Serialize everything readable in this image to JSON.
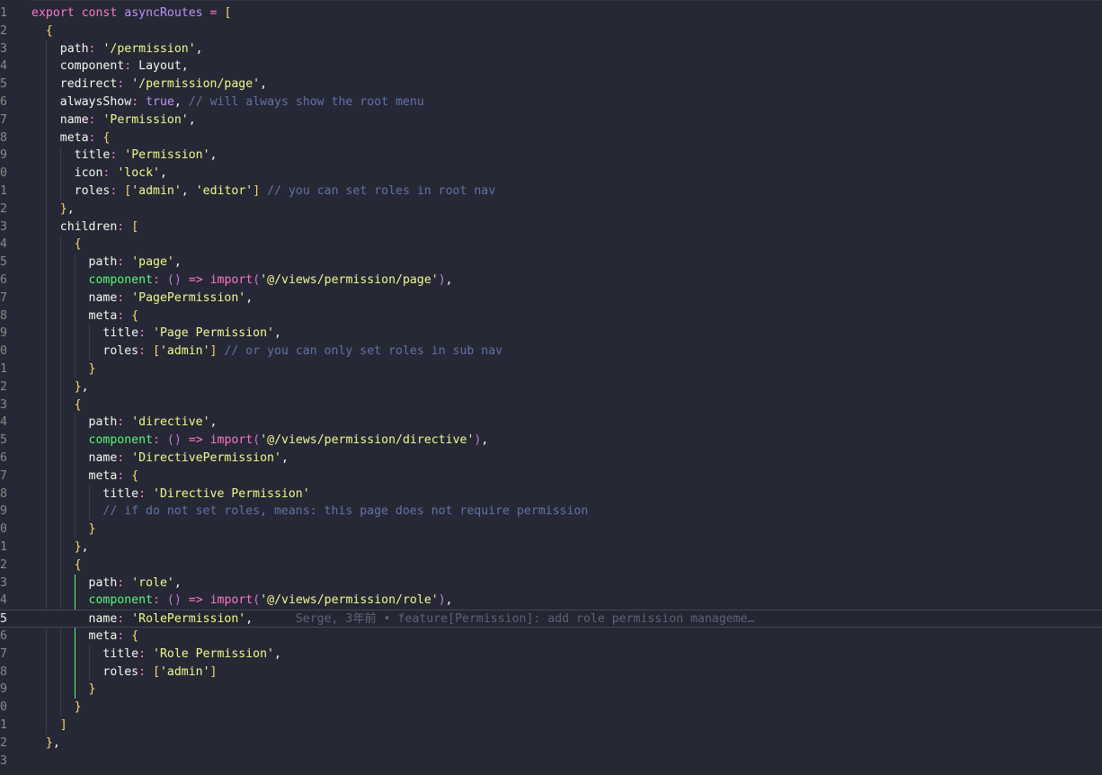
{
  "editor": {
    "line_numbers": [
      "1",
      "2",
      "3",
      "4",
      "5",
      "6",
      "7",
      "8",
      "9",
      "0",
      "1",
      "2",
      "3",
      "4",
      "5",
      "6",
      "7",
      "8",
      "9",
      "0",
      "1",
      "2",
      "3",
      "4",
      "5",
      "6",
      "7",
      "8",
      "9",
      "0",
      "1",
      "2",
      "3",
      "4",
      "5",
      "6",
      "7",
      "8",
      "9",
      "0",
      "1",
      "2",
      "3"
    ],
    "active_line": 35,
    "blame": "Serge, 3年前 • feature[Permission]: add role permission manageme…",
    "lines": [
      "export const asyncRoutes = [",
      "  {",
      "    path: '/permission',",
      "    component: Layout,",
      "    redirect: '/permission/page',",
      "    alwaysShow: true, // will always show the root menu",
      "    name: 'Permission',",
      "    meta: {",
      "      title: 'Permission',",
      "      icon: 'lock',",
      "      roles: ['admin', 'editor'] // you can set roles in root nav",
      "    },",
      "    children: [",
      "      {",
      "        path: 'page',",
      "        component: () => import('@/views/permission/page'),",
      "        name: 'PagePermission',",
      "        meta: {",
      "          title: 'Page Permission',",
      "          roles: ['admin'] // or you can only set roles in sub nav",
      "        }",
      "      },",
      "      {",
      "        path: 'directive',",
      "        component: () => import('@/views/permission/directive'),",
      "        name: 'DirectivePermission',",
      "        meta: {",
      "          title: 'Directive Permission'",
      "          // if do not set roles, means: this page does not require permission",
      "        }",
      "      },",
      "      {",
      "        path: 'role',",
      "        component: () => import('@/views/permission/role'),",
      "        name: 'RolePermission',",
      "        meta: {",
      "          title: 'Role Permission',",
      "          roles: ['admin']",
      "        }",
      "      }",
      "    ]",
      "  },",
      ""
    ]
  },
  "colors": {
    "background": "#262835",
    "keyword": "#ff79c6",
    "string": "#f1fa8c",
    "comment": "#6272a4",
    "active_guide": "#50fa7b"
  }
}
